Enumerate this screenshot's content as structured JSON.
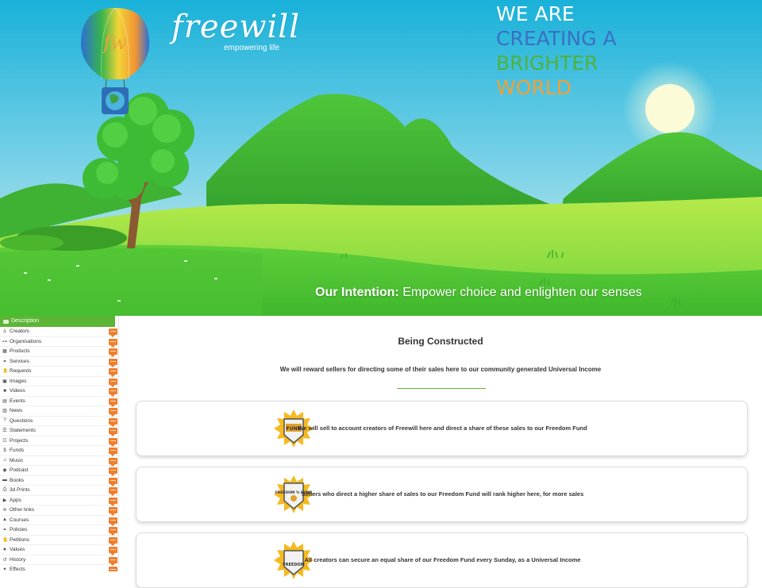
{
  "hero": {
    "brand_name": "freewill",
    "brand_tagline": "empowering life",
    "balloon_monogram": "fw",
    "tagline": [
      {
        "text": "WE ARE",
        "color": "#ffffff"
      },
      {
        "text": "CREATING A",
        "color": "#3a6fc4"
      },
      {
        "text": "BRIGHTER",
        "color": "#4db33d"
      },
      {
        "text": "WORLD",
        "color": "#f0a035"
      }
    ],
    "intention_label": "Our Intention:",
    "intention_text": "Empower choice and enlighten our senses"
  },
  "sidebar": {
    "header": "Description",
    "items": [
      {
        "label": "Creators",
        "icon": "user-icon"
      },
      {
        "label": "Organisations",
        "icon": "sitemap-icon"
      },
      {
        "label": "Products",
        "icon": "store-icon"
      },
      {
        "label": "Services",
        "icon": "handshake-icon"
      },
      {
        "label": "Requests",
        "icon": "hand-icon"
      },
      {
        "label": "Images",
        "icon": "image-icon"
      },
      {
        "label": "Videos",
        "icon": "video-icon"
      },
      {
        "label": "Events",
        "icon": "calendar-icon"
      },
      {
        "label": "News",
        "icon": "newspaper-icon"
      },
      {
        "label": "Questions",
        "icon": "question-icon"
      },
      {
        "label": "Statements",
        "icon": "list-icon"
      },
      {
        "label": "Projects",
        "icon": "tasks-icon"
      },
      {
        "label": "Funds",
        "icon": "dollar-icon"
      },
      {
        "label": "Music",
        "icon": "music-icon"
      },
      {
        "label": "Podcast",
        "icon": "podcast-icon"
      },
      {
        "label": "Books",
        "icon": "book-icon"
      },
      {
        "label": "3d Prints",
        "icon": "printer-icon"
      },
      {
        "label": "Apps",
        "icon": "play-icon"
      },
      {
        "label": "Other links",
        "icon": "wifi-icon"
      },
      {
        "label": "Courses",
        "icon": "graduation-icon"
      },
      {
        "label": "Policies",
        "icon": "handshake-icon"
      },
      {
        "label": "Petitions",
        "icon": "hand-icon"
      },
      {
        "label": "Values",
        "icon": "star-icon"
      },
      {
        "label": "History",
        "icon": "history-icon"
      },
      {
        "label": "Effects",
        "icon": "effects-icon"
      }
    ]
  },
  "main": {
    "title": "Being Constructed",
    "subtitle": "We will reward sellers for directing some of their sales here to our community generated Universal Income",
    "cards": [
      {
        "badge": "FUND",
        "text": "We will sell to account creators of Freewill here and direct a share of these sales to our Freedom Fund"
      },
      {
        "badge": "FREEDOM % FUND",
        "text": "Sellers who direct a higher share of sales to our Freedom Fund will rank higher here, for more sales"
      },
      {
        "badge": "FREEDOM",
        "text": "All creators can secure an equal share of our Freedom Fund every Sunday, as a Universal Income"
      }
    ]
  },
  "colors": {
    "accent_green": "#5cb534",
    "flag_orange": "#ee7f2d",
    "sky_top": "#1fb6db",
    "sky_bottom": "#bfeaf2"
  }
}
